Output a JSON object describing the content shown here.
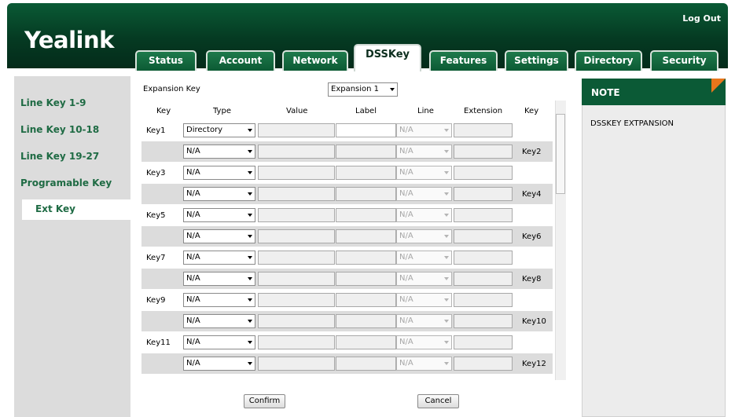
{
  "app": {
    "logo": "Yealink",
    "logout": "Log Out"
  },
  "tabs": [
    {
      "label": "Status",
      "active": false
    },
    {
      "label": "Account",
      "active": false
    },
    {
      "label": "Network",
      "active": false
    },
    {
      "label": "DSSKey",
      "active": true
    },
    {
      "label": "Features",
      "active": false
    },
    {
      "label": "Settings",
      "active": false
    },
    {
      "label": "Directory",
      "active": false
    },
    {
      "label": "Security",
      "active": false
    }
  ],
  "sidebar": {
    "items": [
      {
        "label": "Line Key 1-9"
      },
      {
        "label": "Line Key 10-18"
      },
      {
        "label": "Line Key 19-27"
      },
      {
        "label": "Programable Key"
      },
      {
        "label": "Ext Key",
        "active": true
      }
    ]
  },
  "expansion": {
    "label": "Expansion Key",
    "value": "Expansion 1"
  },
  "table": {
    "headers": [
      "Key",
      "Type",
      "Value",
      "Label",
      "Line",
      "Extension",
      "Key"
    ],
    "rows": [
      {
        "key_left": "Key1",
        "type": "Directory",
        "line": "N/A",
        "key_right": ""
      },
      {
        "key_left": "",
        "type": "N/A",
        "line": "N/A",
        "key_right": "Key2"
      },
      {
        "key_left": "Key3",
        "type": "N/A",
        "line": "N/A",
        "key_right": ""
      },
      {
        "key_left": "",
        "type": "N/A",
        "line": "N/A",
        "key_right": "Key4"
      },
      {
        "key_left": "Key5",
        "type": "N/A",
        "line": "N/A",
        "key_right": ""
      },
      {
        "key_left": "",
        "type": "N/A",
        "line": "N/A",
        "key_right": "Key6"
      },
      {
        "key_left": "Key7",
        "type": "N/A",
        "line": "N/A",
        "key_right": ""
      },
      {
        "key_left": "",
        "type": "N/A",
        "line": "N/A",
        "key_right": "Key8"
      },
      {
        "key_left": "Key9",
        "type": "N/A",
        "line": "N/A",
        "key_right": ""
      },
      {
        "key_left": "",
        "type": "N/A",
        "line": "N/A",
        "key_right": "Key10"
      },
      {
        "key_left": "Key11",
        "type": "N/A",
        "line": "N/A",
        "key_right": ""
      },
      {
        "key_left": "",
        "type": "N/A",
        "line": "N/A",
        "key_right": "Key12"
      }
    ]
  },
  "buttons": {
    "confirm": "Confirm",
    "cancel": "Cancel"
  },
  "note": {
    "title": "NOTE",
    "text": "DSSKEY EXTPANSION"
  },
  "colors": {
    "header_green": "#053a22",
    "link_green": "#1f6b44",
    "accent_orange": "#e8761b"
  }
}
